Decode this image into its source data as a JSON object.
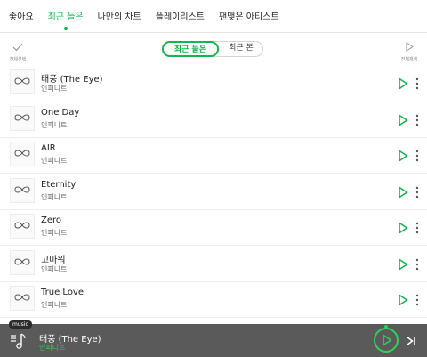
{
  "tabs": [
    {
      "label": "좋아요",
      "active": false
    },
    {
      "label": "최근 들은",
      "active": true
    },
    {
      "label": "나만의 차트",
      "active": false
    },
    {
      "label": "플레이리스트",
      "active": false
    },
    {
      "label": "팬맺은 아티스트",
      "active": false
    }
  ],
  "controls": {
    "select_all_label": "전체선택",
    "play_all_label": "전체재생",
    "segment_active": "최근 들은",
    "segment_inactive": "최근 본"
  },
  "songs": [
    {
      "title": "태풍 (The Eye)",
      "artist": "인피니트"
    },
    {
      "title": "One Day",
      "artist": "인피니트"
    },
    {
      "title": "AIR",
      "artist": "인피니트"
    },
    {
      "title": "Eternity",
      "artist": "인피니트"
    },
    {
      "title": "Zero",
      "artist": "인피니트"
    },
    {
      "title": "고마워",
      "artist": "인피니트"
    },
    {
      "title": "True Love",
      "artist": "인피니트"
    }
  ],
  "player": {
    "badge": "music",
    "title": "태풍 (The Eye)",
    "artist": "인피니트"
  },
  "colors": {
    "accent": "#11b84b",
    "player_bg": "#5a5a5a"
  }
}
